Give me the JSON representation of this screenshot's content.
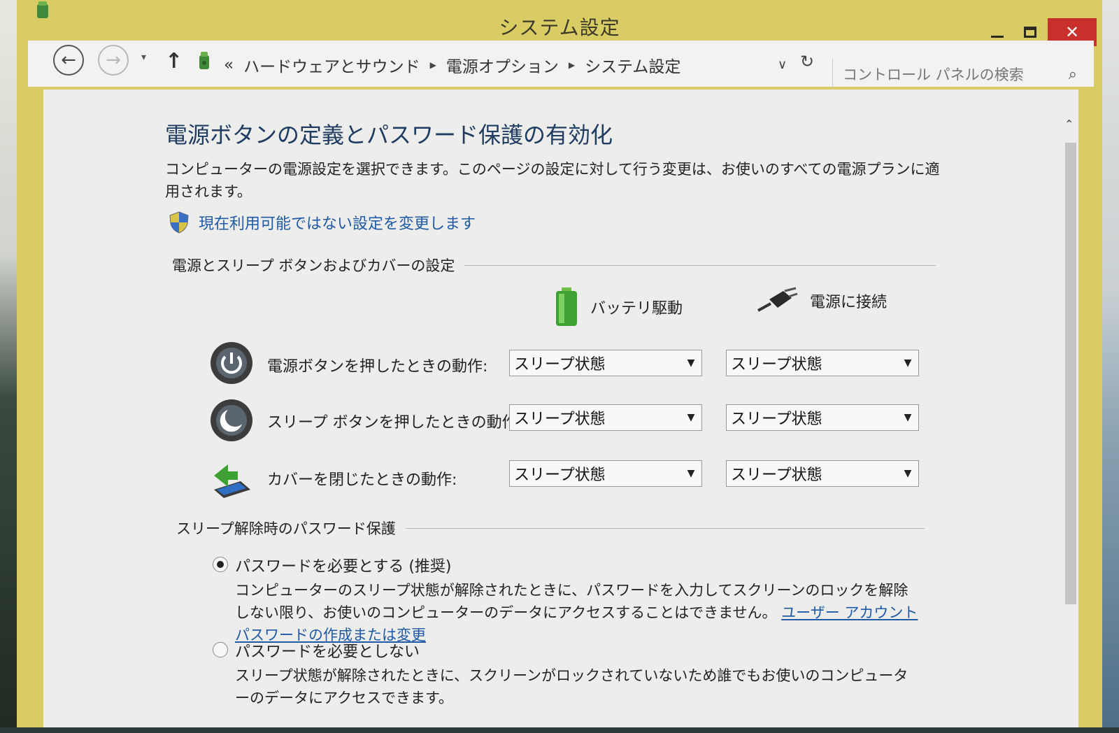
{
  "window": {
    "title": "システム設定",
    "min_icon": "minimize-icon",
    "max_icon": "maximize-icon",
    "close_label": "✕"
  },
  "nav": {
    "back_glyph": "←",
    "forward_glyph": "→",
    "dropdown_glyph": "▾",
    "up_glyph": "↑",
    "overflow": "«",
    "breadcrumbs": [
      "ハードウェアとサウンド",
      "電源オプション",
      "システム設定"
    ],
    "address_dropdown_glyph": "∨",
    "refresh_glyph": "↻",
    "search_placeholder": "コントロール パネルの検索",
    "search_glyph": "⌕"
  },
  "main": {
    "heading": "電源ボタンの定義とパスワード保護の有効化",
    "description": "コンピューターの電源設定を選択できます。このページの設定に対して行う変更は、お使いのすべての電源プランに適用されます。",
    "change_unavailable_link": "現在利用可能ではない設定を変更します",
    "buttons_section_title": "電源とスリープ ボタンおよびカバーの設定",
    "columns": {
      "battery": "バッテリ駆動",
      "plugged_in": "電源に接続"
    },
    "rows": [
      {
        "label": "電源ボタンを押したときの動作:",
        "battery": "スリープ状態",
        "plugged_in": "スリープ状態"
      },
      {
        "label": "スリープ ボタンを押したときの動作:",
        "battery": "スリープ状態",
        "plugged_in": "スリープ状態"
      },
      {
        "label": "カバーを閉じたときの動作:",
        "battery": "スリープ状態",
        "plugged_in": "スリープ状態"
      }
    ],
    "password_section_title": "スリープ解除時のパスワード保護",
    "options": [
      {
        "title": "パスワードを必要とする (推奨)",
        "description": "コンピューターのスリープ状態が解除されたときに、パスワードを入力してスクリーンのロックを解除しない限り、お使いのコンピューターのデータにアクセスすることはできません。",
        "link": "ユーザー アカウント パスワードの作成または変更",
        "selected": true
      },
      {
        "title": "パスワードを必要としない",
        "description": "スリープ状態が解除されたときに、スクリーンがロックされていないため誰でもお使いのコンピューターのデータにアクセスできます。",
        "selected": false
      }
    ]
  },
  "colors": {
    "title_bar": "#d9cc64",
    "close_button": "#c9302c",
    "heading": "#1f3c62",
    "link": "#1f5aa6",
    "content_bg": "#ededeb"
  },
  "dropdown_arrow": "▼",
  "scroll_up_glyph": "⌃"
}
